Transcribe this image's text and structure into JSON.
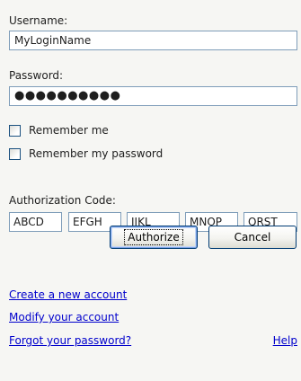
{
  "login": {
    "username_label": "Username:",
    "username_value": "MyLoginName",
    "password_label": "Password:",
    "password_value": "●●●●●●●●●●",
    "remember_me_label": "Remember me",
    "remember_password_label": "Remember my password",
    "remember_me_checked": false,
    "remember_password_checked": false
  },
  "authorization": {
    "label": "Authorization Code:",
    "codes": [
      "ABCD",
      "EFGH",
      "IJKL",
      "MNOP",
      "QRST"
    ]
  },
  "buttons": {
    "authorize_label": "Authorize",
    "cancel_label": "Cancel"
  },
  "links": {
    "create_account": "Create a new account",
    "modify_account": "Modify your account",
    "forgot_password": "Forgot your password?",
    "help": "Help"
  },
  "colors": {
    "background": "#f6f6f3",
    "field_border": "#7f9db9",
    "link": "#0000cc",
    "button_border": "#003c74"
  }
}
